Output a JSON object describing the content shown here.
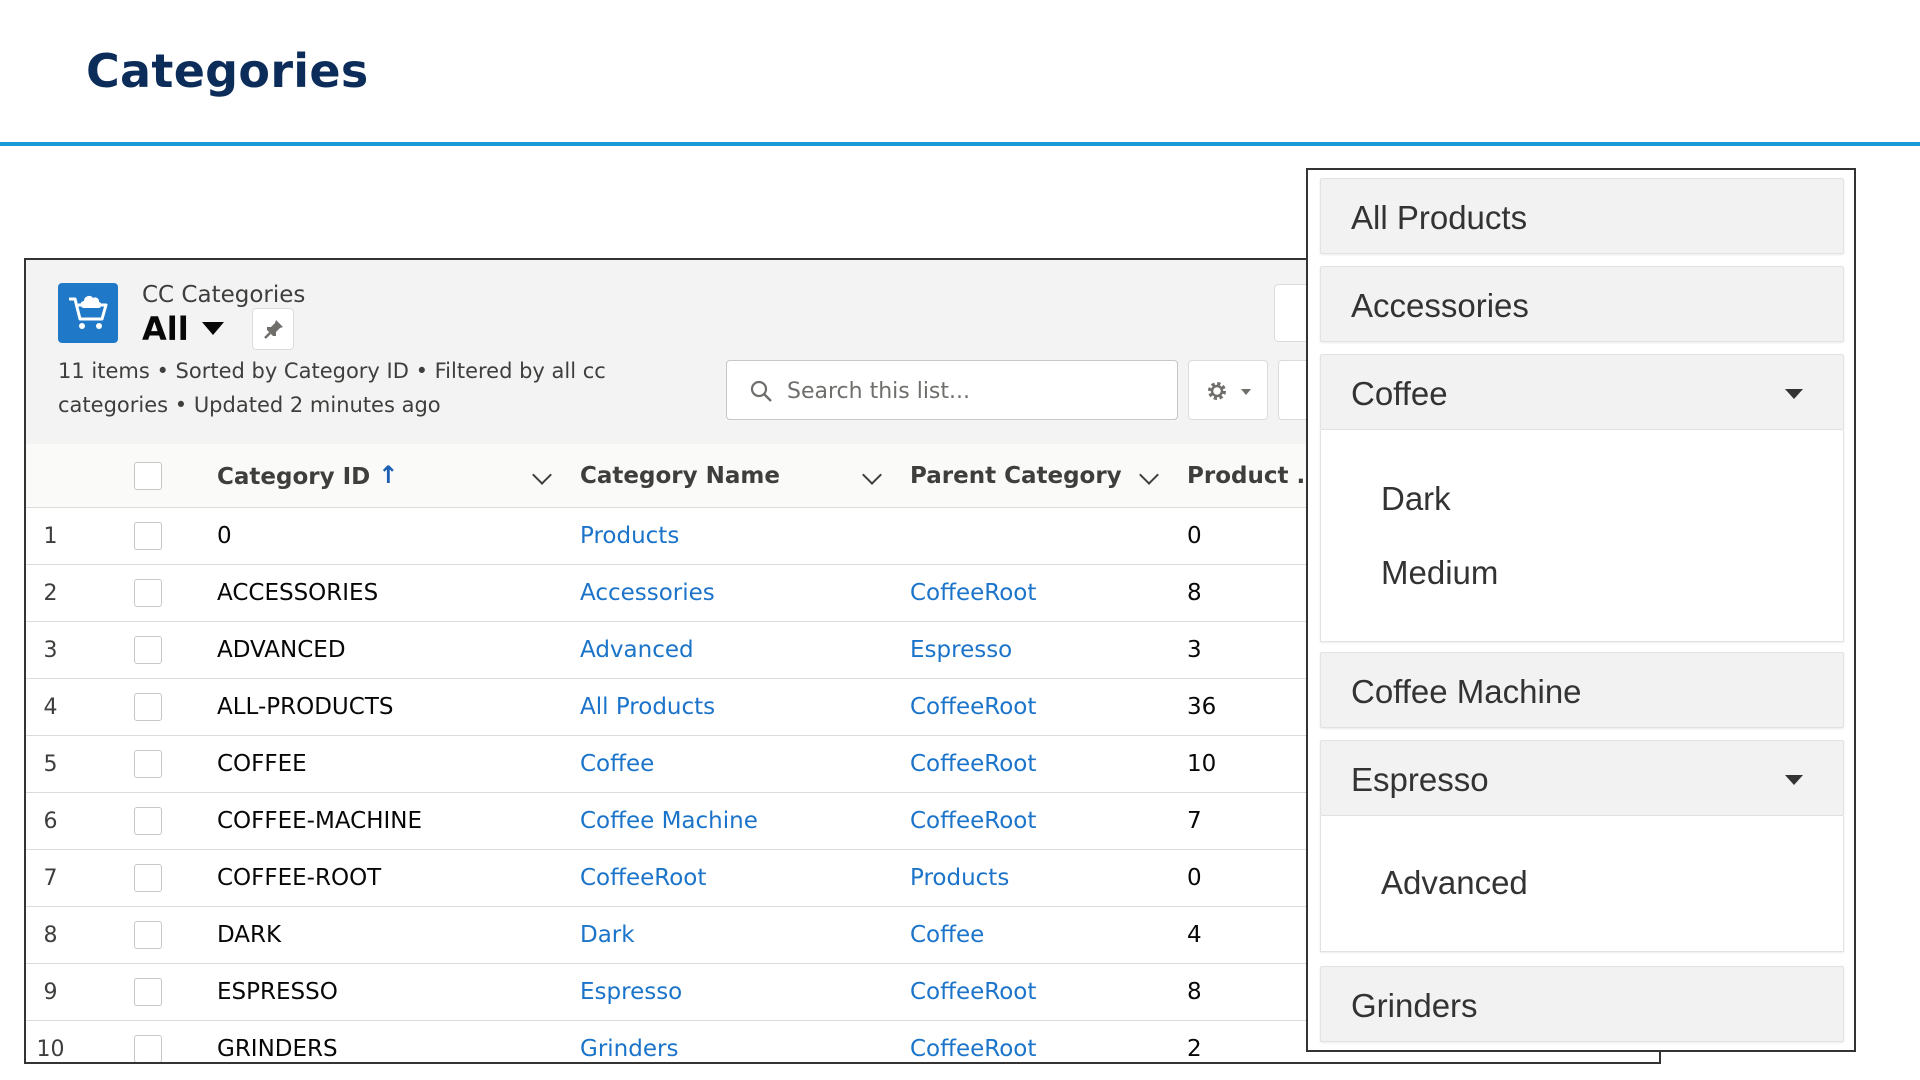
{
  "slide": {
    "title": "Categories"
  },
  "list_view": {
    "object_name": "CC Categories",
    "view_name": "All",
    "info_line1": "11 items • Sorted by Category ID • Filtered by all cc",
    "info_line2": "categories • Updated 2 minutes ago",
    "search_placeholder": "Search this list...",
    "icon_color": "#1f78c8",
    "columns": {
      "category_id": "Category ID",
      "category_name": "Category Name",
      "parent_category": "Parent Category",
      "product": "Product ..."
    },
    "rows": [
      {
        "num": "1",
        "id": "0",
        "name": "Products",
        "parent": "",
        "product": "0"
      },
      {
        "num": "2",
        "id": "ACCESSORIES",
        "name": "Accessories",
        "parent": "CoffeeRoot",
        "product": "8"
      },
      {
        "num": "3",
        "id": "ADVANCED",
        "name": "Advanced",
        "parent": "Espresso",
        "product": "3"
      },
      {
        "num": "4",
        "id": "ALL-PRODUCTS",
        "name": "All Products",
        "parent": "CoffeeRoot",
        "product": "36"
      },
      {
        "num": "5",
        "id": "COFFEE",
        "name": "Coffee",
        "parent": "CoffeeRoot",
        "product": "10"
      },
      {
        "num": "6",
        "id": "COFFEE-MACHINE",
        "name": "Coffee Machine",
        "parent": "CoffeeRoot",
        "product": "7"
      },
      {
        "num": "7",
        "id": "COFFEE-ROOT",
        "name": "CoffeeRoot",
        "parent": "Products",
        "product": "0"
      },
      {
        "num": "8",
        "id": "DARK",
        "name": "Dark",
        "parent": "Coffee",
        "product": "4"
      },
      {
        "num": "9",
        "id": "ESPRESSO",
        "name": "Espresso",
        "parent": "CoffeeRoot",
        "product": "8"
      },
      {
        "num": "10",
        "id": "GRINDERS",
        "name": "Grinders",
        "parent": "CoffeeRoot",
        "product": "2"
      }
    ]
  },
  "menu": {
    "items": [
      {
        "label": "All Products"
      },
      {
        "label": "Accessories"
      },
      {
        "label": "Coffee",
        "children": [
          "Dark",
          "Medium"
        ]
      },
      {
        "label": "Coffee Machine"
      },
      {
        "label": "Espresso",
        "children": [
          "Advanced"
        ]
      },
      {
        "label": "Grinders"
      }
    ]
  },
  "colors": {
    "title": "#0c2d5a",
    "rule": "#1a9ad6",
    "link": "#1b74c9"
  }
}
